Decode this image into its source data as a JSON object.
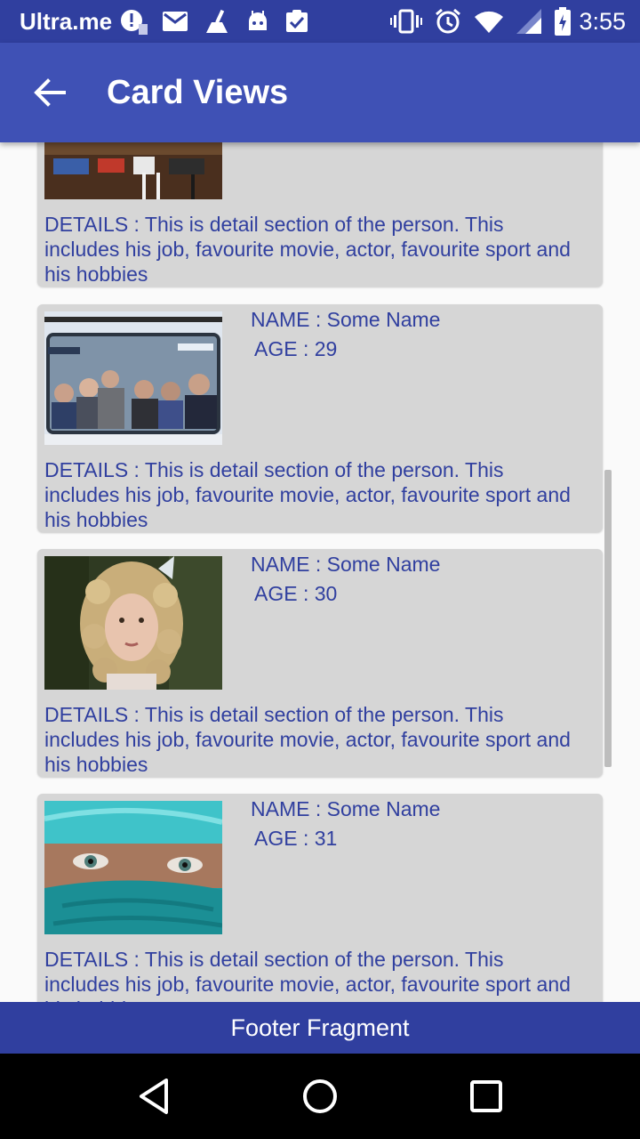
{
  "status_bar": {
    "carrier": "Ultra.me",
    "time": "3:55",
    "left_icons": [
      "alert-icon",
      "mail-icon",
      "broom-icon",
      "android-icon",
      "clipboard-check-icon"
    ],
    "right_icons": [
      "vibrate-icon",
      "alarm-icon",
      "wifi-icon",
      "signal-icon",
      "battery-icon"
    ]
  },
  "app_bar": {
    "title": "Card Views",
    "back_icon": "arrow-left-icon"
  },
  "cards": [
    {
      "name": "",
      "age": "",
      "details": "DETAILS : This is detail section of the person. This includes his job, favourite movie, actor, favourite sport and his hobbies",
      "photo": "market-stall-photo"
    },
    {
      "name": "NAME : Some Name",
      "age": "AGE : 29",
      "details": "DETAILS : This is detail section of the person. This includes his job, favourite movie, actor, favourite sport and his hobbies",
      "photo": "subway-passengers-photo"
    },
    {
      "name": "NAME : Some Name",
      "age": "AGE : 30",
      "details": "DETAILS : This is detail section of the person. This includes his job, favourite movie, actor, favourite sport and his hobbies",
      "photo": "curly-haired-girl-photo"
    },
    {
      "name": "NAME : Some Name",
      "age": "AGE : 31",
      "details": "DETAILS : This is detail section of the person. This includes his job, favourite movie, actor, favourite sport and his hobbies",
      "photo": "veiled-face-photo"
    }
  ],
  "footer": {
    "label": "Footer Fragment"
  },
  "nav_bar": {
    "icons": [
      "back-triangle-icon",
      "home-circle-icon",
      "recents-square-icon"
    ]
  },
  "colors": {
    "status_bar": "#303f9f",
    "app_bar": "#3f51b5",
    "card_background": "#d6d6d6",
    "card_text": "#303f9f",
    "footer": "#303f9f"
  }
}
